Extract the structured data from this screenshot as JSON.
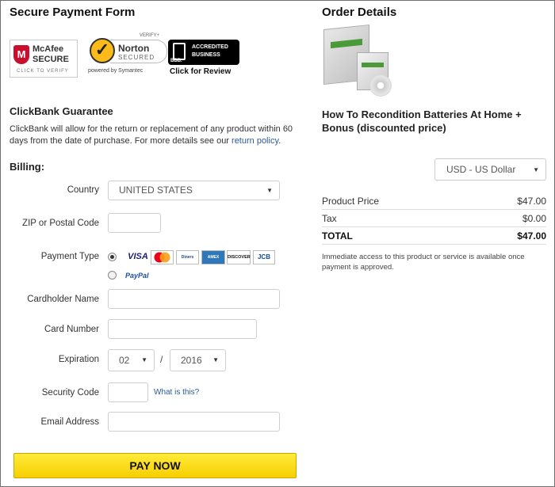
{
  "form": {
    "title": "Secure Payment Form"
  },
  "badges": {
    "mcafee": {
      "line1": "McAfee",
      "line2": "SECURE",
      "sub": "CLICK TO VERIFY",
      "mark": "M"
    },
    "norton": {
      "verify": "VERIFY+",
      "name": "Norton",
      "secured": "SECURED",
      "powered": "powered by Symantec"
    },
    "bbb": {
      "logo": "BBB.",
      "line1": "ACCREDITED",
      "line2": "BUSINESS",
      "cta": "Click for Review"
    }
  },
  "guarantee": {
    "title": "ClickBank Guarantee",
    "text": "ClickBank will allow for the return or replacement of any product within 60 days from the date of purchase. For more details see our ",
    "link": "return policy",
    "end": "."
  },
  "billing": {
    "title": "Billing:",
    "country_label": "Country",
    "country_value": "UNITED STATES",
    "zip_label": "ZIP or Postal Code",
    "zip_value": "",
    "payment_label": "Payment Type",
    "cards": [
      "VISA",
      "MasterCard",
      "Diners",
      "AMEX",
      "DISCOVER",
      "JCB"
    ],
    "paypal": "PayPal",
    "cardholder_label": "Cardholder Name",
    "card_number_label": "Card Number",
    "expiration_label": "Expiration",
    "exp_month": "02",
    "exp_sep": "/",
    "exp_year": "2016",
    "security_label": "Security Code",
    "security_help": "What is this?",
    "email_label": "Email Address"
  },
  "pay_button": "PAY NOW",
  "order": {
    "title": "Order Details",
    "product": "How To Recondition Batteries At Home + Bonus (discounted price)",
    "currency": "USD - US Dollar",
    "rows": [
      {
        "label": "Product Price",
        "value": "$47.00"
      },
      {
        "label": "Tax",
        "value": "$0.00"
      },
      {
        "label": "TOTAL",
        "value": "$47.00"
      }
    ],
    "note": "Immediate access to this product or service is available once payment is approved."
  },
  "colors": {
    "accent_link": "#2a5a9c",
    "pay_button": "#f7d000",
    "mcafee_red": "#c8102e",
    "norton_yellow": "#fdbb1b"
  }
}
